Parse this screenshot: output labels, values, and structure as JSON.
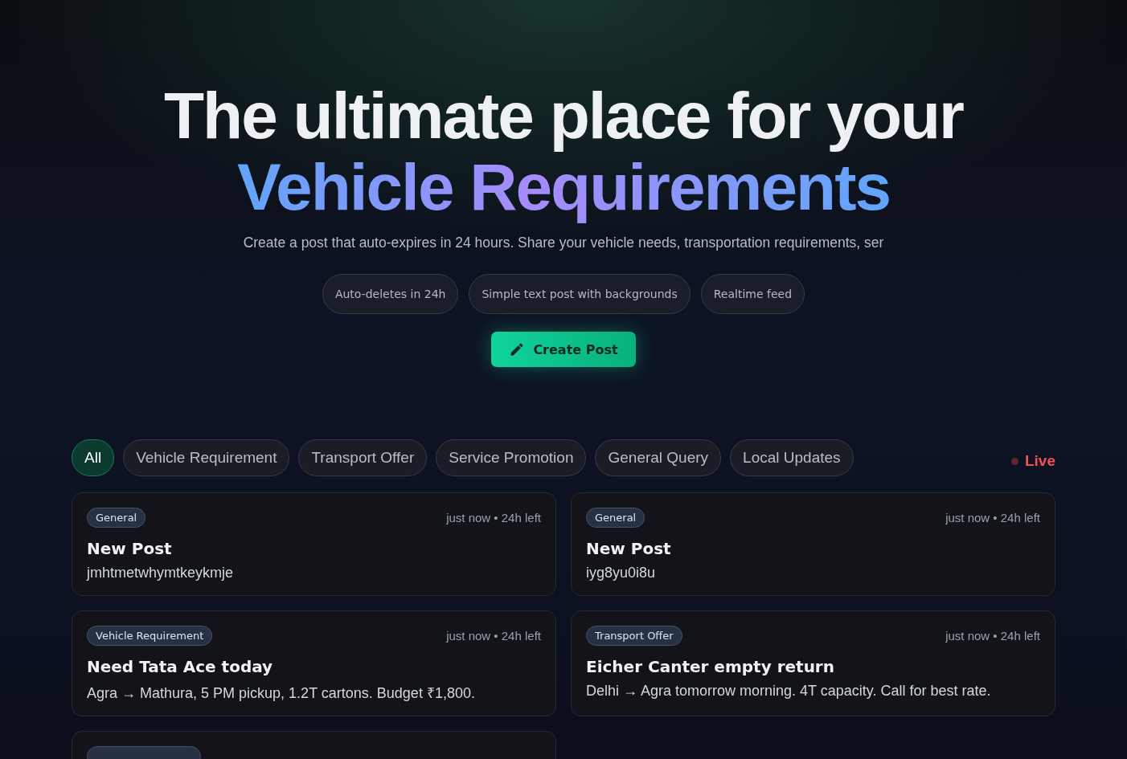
{
  "hero": {
    "title_line1": "The ultimate place for your",
    "title_line2": "Vehicle Requirements",
    "subtitle": "Create a post that auto-expires in 24 hours. Share your vehicle needs, transportation requirements, ser",
    "features": [
      "Auto-deletes in 24h",
      "Simple text post with backgrounds",
      "Realtime feed"
    ],
    "create_button": "Create Post"
  },
  "filters": [
    {
      "label": "All",
      "selected": true
    },
    {
      "label": "Vehicle Requirement",
      "selected": false
    },
    {
      "label": "Transport Offer",
      "selected": false
    },
    {
      "label": "Service Promotion",
      "selected": false
    },
    {
      "label": "General Query",
      "selected": false
    },
    {
      "label": "Local Updates",
      "selected": false
    }
  ],
  "live": {
    "label": "Live",
    "on": false
  },
  "posts": [
    {
      "kind": "full",
      "category": "General",
      "time": "just now",
      "separator": "•",
      "remaining": "24h left",
      "title": "New Post",
      "body": "jmhtmetwhymtkeykmje"
    },
    {
      "kind": "full",
      "category": "General",
      "time": "just now",
      "separator": "•",
      "remaining": "24h left",
      "title": "New Post",
      "body": "iyg8yu0i8u"
    },
    {
      "kind": "full",
      "category": "Vehicle Requirement",
      "time": "just now",
      "separator": "•",
      "remaining": "24h left",
      "title": "Need Tata Ace today",
      "body": "Agra → Mathura, 5 PM pickup, 1.2T cartons. Budget ₹1,800."
    },
    {
      "kind": "full",
      "category": "Transport Offer",
      "time": "just now",
      "separator": "•",
      "remaining": "24h left",
      "title": "Eicher Canter empty return",
      "body": "Delhi → Agra tomorrow morning. 4T capacity. Call for best rate."
    },
    {
      "kind": "cut"
    }
  ]
}
